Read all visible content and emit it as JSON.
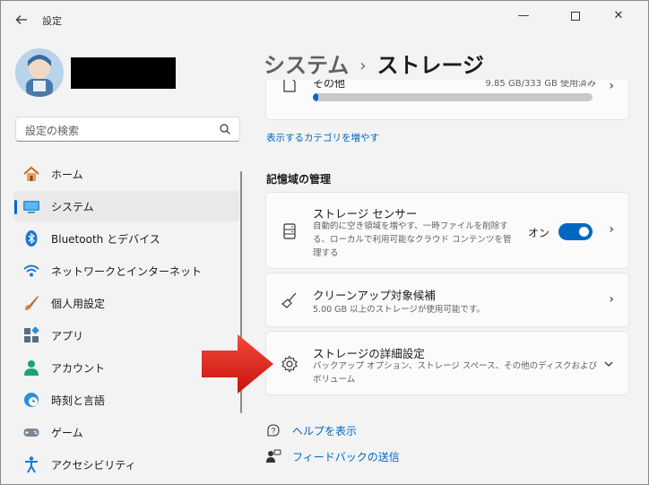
{
  "titlebar": {
    "back_icon": "back-arrow-icon",
    "app_title": "設定",
    "minimize_glyph": "—",
    "close_glyph": "✕"
  },
  "search": {
    "placeholder": "設定の検索",
    "icon": "search-icon"
  },
  "sidebar": {
    "items": [
      {
        "label": "ホーム",
        "icon": "home-icon",
        "selected": false
      },
      {
        "label": "システム",
        "icon": "system-monitor-icon",
        "selected": true
      },
      {
        "label": "Bluetooth とデバイス",
        "icon": "bluetooth-icon",
        "selected": false
      },
      {
        "label": "ネットワークとインターネット",
        "icon": "wifi-icon",
        "selected": false
      },
      {
        "label": "個人用設定",
        "icon": "paintbrush-icon",
        "selected": false
      },
      {
        "label": "アプリ",
        "icon": "apps-icon",
        "selected": false
      },
      {
        "label": "アカウント",
        "icon": "account-icon",
        "selected": false
      },
      {
        "label": "時刻と言語",
        "icon": "time-language-icon",
        "selected": false
      },
      {
        "label": "ゲーム",
        "icon": "gamepad-icon",
        "selected": false
      },
      {
        "label": "アクセシビリティ",
        "icon": "accessibility-icon",
        "selected": false
      }
    ]
  },
  "breadcrumb": {
    "parent": "システム",
    "separator": "›",
    "current": "ストレージ"
  },
  "other_item": {
    "title": "その他",
    "usage": "9.85 GB/333 GB 使用済み",
    "progress_fraction": 0.02
  },
  "show_more_link": "表示するカテゴリを増やす",
  "storage_management": {
    "section_title": "記憶域の管理",
    "cards": [
      {
        "title": "ストレージ センサー",
        "description": "自動的に空き領域を増やす、一時ファイルを削除する、ローカルで利用可能なクラウド コンテンツを管理する",
        "icon": "storage-drive-icon",
        "toggle_label": "オン",
        "toggle_on": true
      },
      {
        "title": "クリーンアップ対象候補",
        "description": "5.00 GB 以上のストレージが使用可能です。",
        "icon": "broom-icon"
      },
      {
        "title": "ストレージの詳細設定",
        "description": "バックアップ オプション、ストレージ スペース、その他のディスクおよびボリューム",
        "icon": "gear-icon"
      }
    ]
  },
  "help_links": [
    {
      "label": "ヘルプを表示",
      "icon": "help-icon"
    },
    {
      "label": "フィードバックの送信",
      "icon": "feedback-icon"
    }
  ],
  "colors": {
    "accent": "#0067c0",
    "arrow": "#e8201c",
    "background": "#f3f3f3"
  }
}
